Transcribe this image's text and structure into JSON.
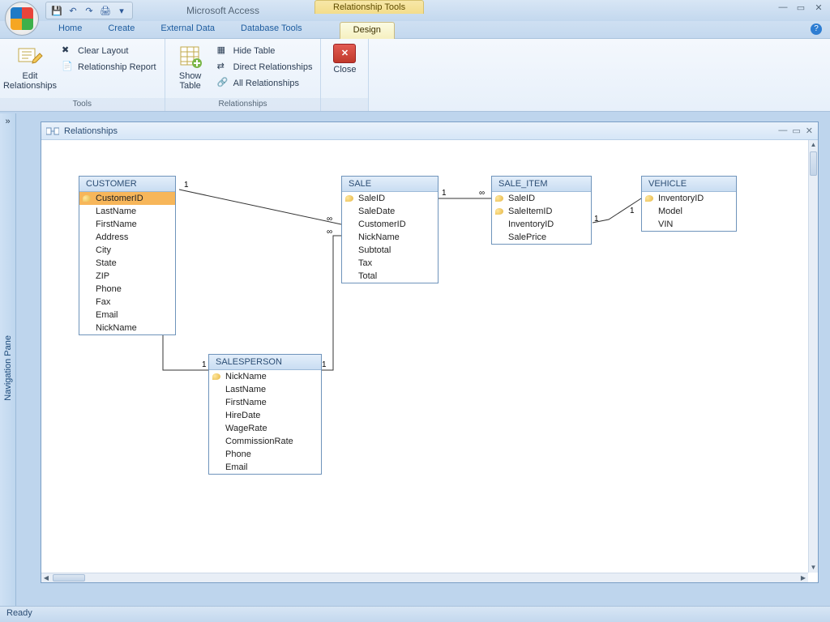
{
  "app_title": "Microsoft Access",
  "context_tab": "Relationship Tools",
  "tabs": {
    "home": "Home",
    "create": "Create",
    "external": "External Data",
    "dbtools": "Database Tools",
    "design": "Design"
  },
  "ribbon": {
    "edit_relationships": "Edit\nRelationships",
    "clear_layout": "Clear Layout",
    "relationship_report": "Relationship Report",
    "tools_group": "Tools",
    "show_table": "Show\nTable",
    "hide_table": "Hide Table",
    "direct_relationships": "Direct Relationships",
    "all_relationships": "All Relationships",
    "relationships_group": "Relationships",
    "close": "Close"
  },
  "nav_pane": "Navigation Pane",
  "relwin_title": "Relationships",
  "tables": {
    "customer": {
      "title": "CUSTOMER",
      "fields": [
        "CustomerID",
        "LastName",
        "FirstName",
        "Address",
        "City",
        "State",
        "ZIP",
        "Phone",
        "Fax",
        "Email",
        "NickName"
      ],
      "pks": [
        0
      ]
    },
    "salesperson": {
      "title": "SALESPERSON",
      "fields": [
        "NickName",
        "LastName",
        "FirstName",
        "HireDate",
        "WageRate",
        "CommissionRate",
        "Phone",
        "Email"
      ],
      "pks": [
        0
      ]
    },
    "sale": {
      "title": "SALE",
      "fields": [
        "SaleID",
        "SaleDate",
        "CustomerID",
        "NickName",
        "Subtotal",
        "Tax",
        "Total"
      ],
      "pks": [
        0
      ]
    },
    "sale_item": {
      "title": "SALE_ITEM",
      "fields": [
        "SaleID",
        "SaleItemID",
        "InventoryID",
        "SalePrice"
      ],
      "pks": [
        0,
        1
      ]
    },
    "vehicle": {
      "title": "VEHICLE",
      "fields": [
        "InventoryID",
        "Model",
        "VIN"
      ],
      "pks": [
        0
      ]
    }
  },
  "status": "Ready"
}
